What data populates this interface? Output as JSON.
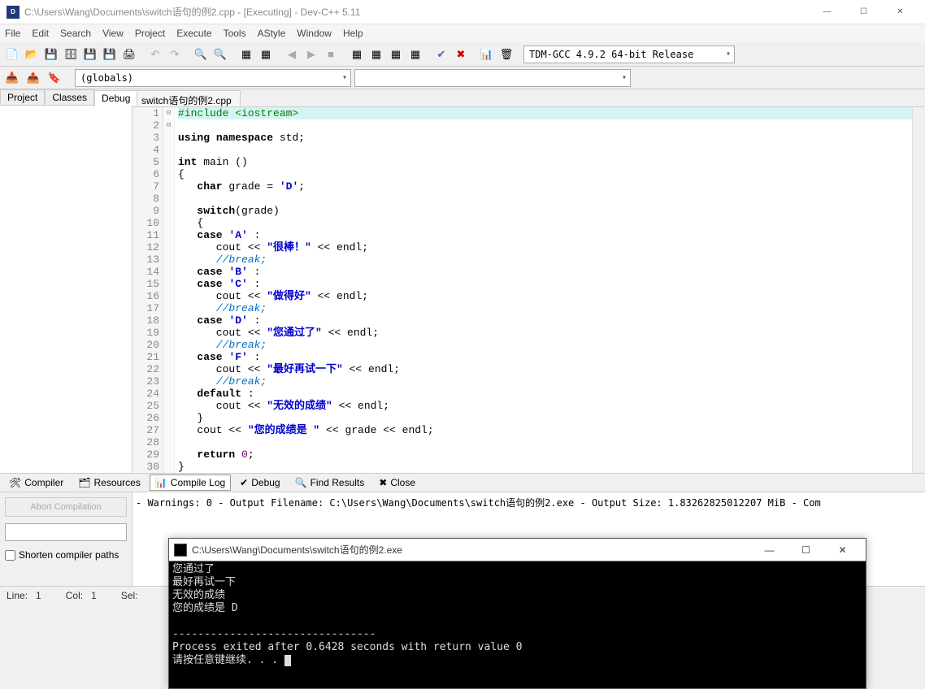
{
  "window": {
    "title": "C:\\Users\\Wang\\Documents\\switch语句的例2.cpp - [Executing] - Dev-C++ 5.11"
  },
  "menu": [
    "File",
    "Edit",
    "Search",
    "View",
    "Project",
    "Execute",
    "Tools",
    "AStyle",
    "Window",
    "Help"
  ],
  "compiler_combo": "TDM-GCC 4.9.2 64-bit Release",
  "scope_combo": "(globals)",
  "left_tabs": [
    "Project",
    "Classes",
    "Debug"
  ],
  "left_tab_active": 2,
  "file_tab": "switch语句的例2.cpp",
  "code_lines": [
    {
      "n": 1,
      "hl": true,
      "html": "<span class='pre'>#include &lt;iostream&gt;</span>"
    },
    {
      "n": 2,
      "html": "<span class='kw'>using</span> <span class='kw'>namespace</span> std;"
    },
    {
      "n": 3,
      "html": ""
    },
    {
      "n": 4,
      "html": "<span class='kw'>int</span> main ()"
    },
    {
      "n": 5,
      "fold": "⊟",
      "html": "{"
    },
    {
      "n": 6,
      "html": "   <span class='kw'>char</span> grade = <span class='str'>'D'</span>;"
    },
    {
      "n": 7,
      "html": ""
    },
    {
      "n": 8,
      "html": "   <span class='kw'>switch</span>(grade)"
    },
    {
      "n": 9,
      "fold": "⊟",
      "html": "   {"
    },
    {
      "n": 10,
      "html": "   <span class='kw'>case</span> <span class='str'>'A'</span> :"
    },
    {
      "n": 11,
      "html": "      cout &lt;&lt; <span class='str'>\"很棒！\"</span> &lt;&lt; endl;"
    },
    {
      "n": 12,
      "html": "      <span class='cm'>//break;</span>"
    },
    {
      "n": 13,
      "html": "   <span class='kw'>case</span> <span class='str'>'B'</span> :"
    },
    {
      "n": 14,
      "html": "   <span class='kw'>case</span> <span class='str'>'C'</span> :"
    },
    {
      "n": 15,
      "html": "      cout &lt;&lt; <span class='str'>\"做得好\"</span> &lt;&lt; endl;"
    },
    {
      "n": 16,
      "html": "      <span class='cm'>//break;</span>"
    },
    {
      "n": 17,
      "html": "   <span class='kw'>case</span> <span class='str'>'D'</span> :"
    },
    {
      "n": 18,
      "html": "      cout &lt;&lt; <span class='str'>\"您通过了\"</span> &lt;&lt; endl;"
    },
    {
      "n": 19,
      "html": "      <span class='cm'>//break;</span>"
    },
    {
      "n": 20,
      "html": "   <span class='kw'>case</span> <span class='str'>'F'</span> :"
    },
    {
      "n": 21,
      "html": "      cout &lt;&lt; <span class='str'>\"最好再试一下\"</span> &lt;&lt; endl;"
    },
    {
      "n": 22,
      "html": "      <span class='cm'>//break;</span>"
    },
    {
      "n": 23,
      "html": "   <span class='kw'>default</span> :"
    },
    {
      "n": 24,
      "html": "      cout &lt;&lt; <span class='str'>\"无效的成绩\"</span> &lt;&lt; endl;"
    },
    {
      "n": 25,
      "html": "   }"
    },
    {
      "n": 26,
      "html": "   cout &lt;&lt; <span class='str'>\"您的成绩是 \"</span> &lt;&lt; grade &lt;&lt; endl;"
    },
    {
      "n": 27,
      "html": ""
    },
    {
      "n": 28,
      "html": "   <span class='kw'>return</span> <span class='num'>0</span>;"
    },
    {
      "n": 29,
      "html": "}"
    },
    {
      "n": 30,
      "html": ""
    }
  ],
  "bottom_tabs": [
    {
      "icon": "🛠",
      "label": "Compiler"
    },
    {
      "icon": "🗂",
      "label": "Resources"
    },
    {
      "icon": "📊",
      "label": "Compile Log",
      "active": true
    },
    {
      "icon": "✔",
      "label": "Debug"
    },
    {
      "icon": "🔍",
      "label": "Find Results"
    },
    {
      "icon": "✖",
      "label": "Close"
    }
  ],
  "abort_label": "Abort Compilation",
  "shorten_label": "Shorten compiler paths",
  "compile_log": [
    "- Warnings: 0",
    "- Output Filename: C:\\Users\\Wang\\Documents\\switch语句的例2.exe",
    "- Output Size: 1.83262825012207 MiB",
    "- Com"
  ],
  "status": {
    "line_lbl": "Line:",
    "line": "1",
    "col_lbl": "Col:",
    "col": "1",
    "sel_lbl": "Sel:"
  },
  "console": {
    "title": "C:\\Users\\Wang\\Documents\\switch语句的例2.exe",
    "lines": [
      "您通过了",
      "最好再试一下",
      "无效的成绩",
      "您的成绩是 D",
      "",
      "--------------------------------",
      "Process exited after 0.6428 seconds with return value 0",
      "请按任意键继续. . . "
    ]
  }
}
